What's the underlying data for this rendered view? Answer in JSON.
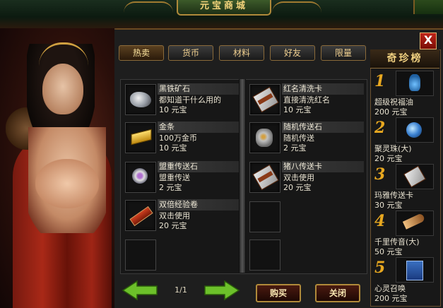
{
  "window": {
    "title": "元宝商城",
    "close_label": "X"
  },
  "tabs": [
    "热卖",
    "货币",
    "材料",
    "好友",
    "限量"
  ],
  "items_left": [
    {
      "name": "黑铁矿石",
      "desc": "都知道干什么用的",
      "price": "10 元宝",
      "icon": "ore-icon"
    },
    {
      "name": "金条",
      "desc": "100万金币",
      "price": "10 元宝",
      "icon": "gold-bar-icon"
    },
    {
      "name": "盟重传送石",
      "desc": "盟重传送",
      "price": "2 元宝",
      "icon": "teleport-stone-icon"
    },
    {
      "name": "双倍经验卷",
      "desc": "双击使用",
      "price": "20 元宝",
      "icon": "scroll-icon"
    }
  ],
  "items_right": [
    {
      "name": "红名清洗卡",
      "desc": "直接清洗红名",
      "price": "10 元宝",
      "icon": "card-icon"
    },
    {
      "name": "随机传送石",
      "desc": "随机传送",
      "price": "2 元宝",
      "icon": "stone-icon"
    },
    {
      "name": "猪八传送卡",
      "desc": "双击使用",
      "price": "20 元宝",
      "icon": "card-icon"
    }
  ],
  "pagination": {
    "page": "1/1"
  },
  "buttons": {
    "buy": "购买",
    "close": "关闭"
  },
  "ranking": {
    "title": "奇珍榜",
    "entries": [
      {
        "rank": "1",
        "name": "超级祝福油",
        "price": "200 元宝",
        "icon": "oil-bottle-icon"
      },
      {
        "rank": "2",
        "name": "聚灵珠(大)",
        "price": "20 元宝",
        "icon": "bead-icon"
      },
      {
        "rank": "3",
        "name": "玛雅传送卡",
        "price": "30 元宝",
        "icon": "card-icon"
      },
      {
        "rank": "4",
        "name": "千里传音(大)",
        "price": "50 元宝",
        "icon": "horn-icon"
      },
      {
        "rank": "5",
        "name": "心灵召唤",
        "price": "200 元宝",
        "icon": "book-icon"
      }
    ]
  },
  "colors": {
    "accent_gold": "#f0d080",
    "close_red": "#c02418",
    "arrow_green": "#6cc02a"
  }
}
